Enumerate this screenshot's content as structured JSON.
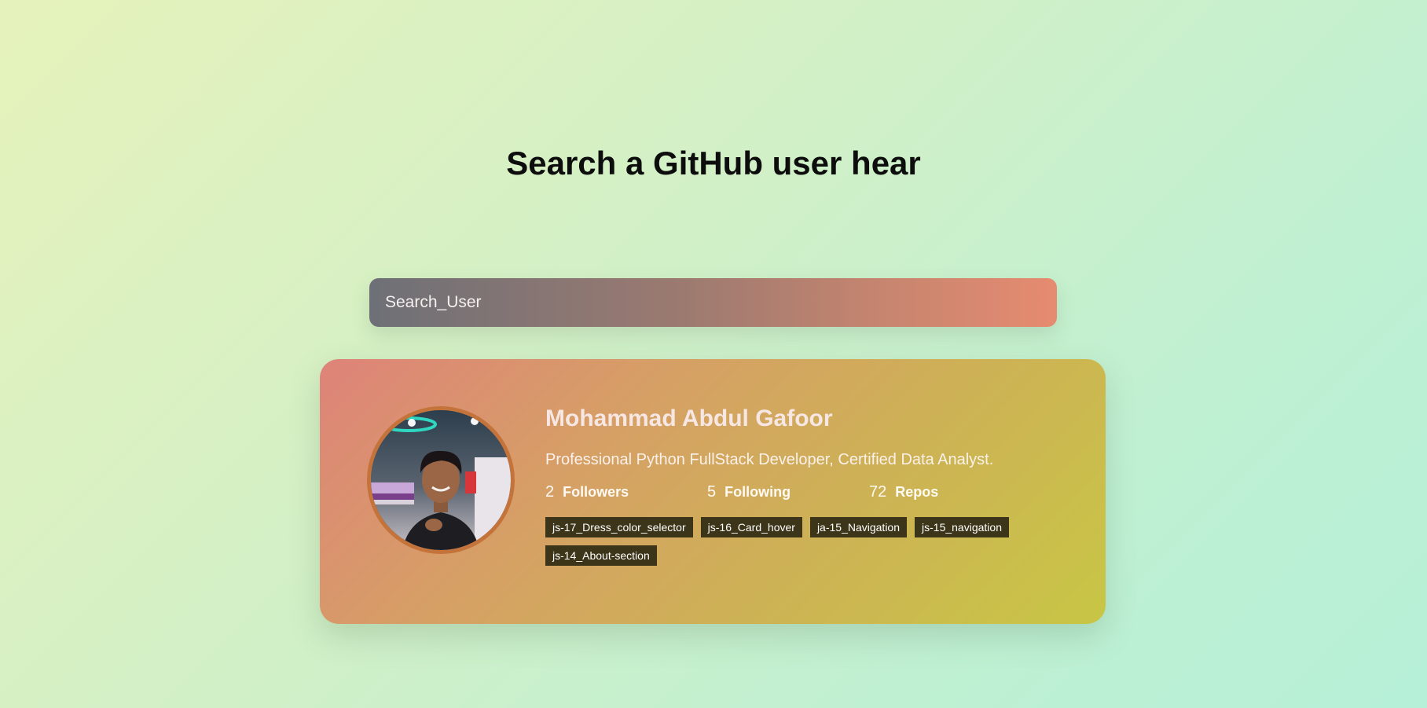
{
  "header": {
    "title": "Search a GitHub user hear"
  },
  "search": {
    "placeholder": "Search_User"
  },
  "profile": {
    "avatar_icon": "profile-photo",
    "name": "Mohammad Abdul Gafoor",
    "bio": "Professional Python FullStack Developer, Certified Data Analyst.",
    "stats": [
      {
        "count": "2",
        "label": "Followers"
      },
      {
        "count": "5",
        "label": "Following"
      },
      {
        "count": "72",
        "label": "Repos"
      }
    ],
    "repos": [
      "js-17_Dress_color_selector",
      "js-16_Card_hover",
      "ja-15_Navigation",
      "js-15_navigation",
      "js-14_About-section"
    ]
  },
  "colors": {
    "card_border_accent": "#c4733a",
    "repo_tag_bg": "#3d3519"
  }
}
